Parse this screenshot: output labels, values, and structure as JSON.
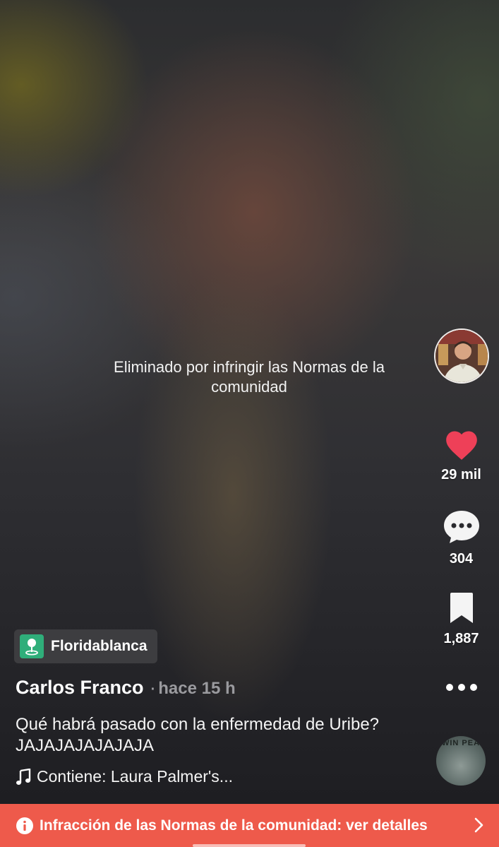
{
  "video": {
    "removed_notice": "Eliminado por infringir las Normas de la comunidad"
  },
  "actions": {
    "likes": "29 mil",
    "comments": "304",
    "saves": "1,887"
  },
  "location": {
    "label": "Floridablanca"
  },
  "post": {
    "author": "Carlos Franco",
    "separator": "·",
    "time": "hace 15 h",
    "caption": "Qué habrá pasado con la enfermedad de Uribe? JAJAJAJAJAJAJA",
    "music": "Contiene: Laura Palmer's..."
  },
  "disc": {
    "label": "WIN PEA"
  },
  "banner": {
    "text": "Infracción de las Normas de la comunidad: ver detalles"
  },
  "colors": {
    "like": "#ee4058",
    "banner": "#ee5a4b",
    "location_pin": "#2fae7a"
  },
  "icons": {
    "like": "heart-icon",
    "comment": "comment-bubble-icon",
    "save": "bookmark-icon",
    "more": "more-dots-icon",
    "music": "music-note-icon",
    "location": "location-pin-icon",
    "info": "info-icon",
    "chevron": "chevron-right-icon"
  }
}
